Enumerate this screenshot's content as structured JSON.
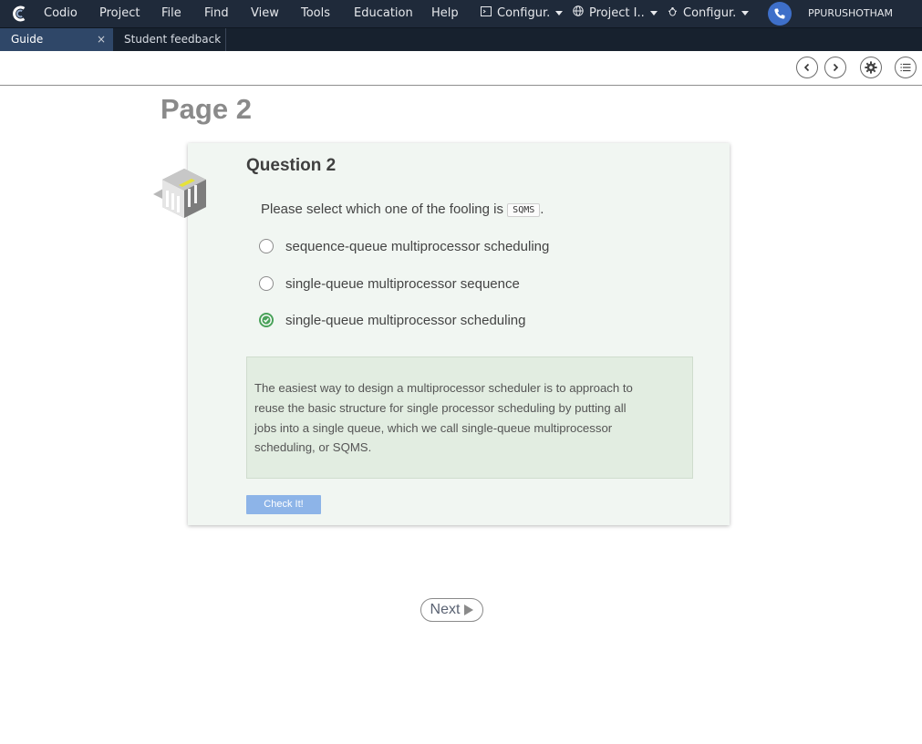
{
  "menubar": {
    "items": [
      "Codio",
      "Project",
      "File",
      "Find",
      "View",
      "Tools",
      "Education",
      "Help"
    ],
    "dropdowns": [
      {
        "label": "Configur.",
        "icon": "terminal-icon"
      },
      {
        "label": "Project I..",
        "icon": "globe-icon"
      },
      {
        "label": "Configur.",
        "icon": "bug-icon"
      }
    ],
    "user": "PPURUSHOTHAM"
  },
  "tabs": [
    {
      "label": "Guide",
      "active": true,
      "close": "×"
    },
    {
      "label": "Student feedback",
      "active": false
    }
  ],
  "page": {
    "title": "Page 2",
    "question_title": "Question 2",
    "prompt": "Please select which one of the fooling is",
    "prompt_code": "SQMS",
    "prompt_end": ".",
    "options": [
      {
        "label": "sequence-queue multiprocessor scheduling",
        "selected": false
      },
      {
        "label": "single-queue multiprocessor sequence",
        "selected": false
      },
      {
        "label": "single-queue multiprocessor scheduling",
        "selected": true
      }
    ],
    "feedback_lines": [
      "The easiest way to design a multiprocessor scheduler is to approach to",
      "reuse the basic structure for single processor scheduling by putting all",
      "jobs into a single queue, which we call single-queue multiprocessor",
      "scheduling, or SQMS."
    ],
    "check_button": "Check It!",
    "next_button": "Next"
  },
  "colors": {
    "menubar_bg": "#1f2a3a",
    "active_tab": "#2f4768",
    "card_bg": "#f1f6f2",
    "feedback_bg": "#e2ede1",
    "selected_radio": "#4aa25a",
    "check_button": "#8db4e8"
  }
}
